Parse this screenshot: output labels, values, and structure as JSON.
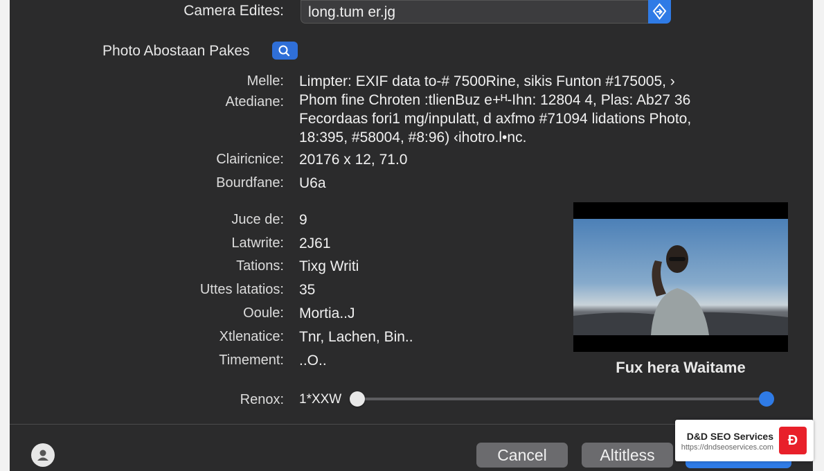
{
  "file": {
    "label": "Camera Edites:",
    "value": "long.tum er.jg"
  },
  "photo_section": {
    "label": "Photo Abostaan Pakes"
  },
  "description": {
    "label_1": "Melle:",
    "label_2": "Atediane:",
    "lines": [
      "Limpter: EXIF data to-# 7500Rine, sikis Funton  #175005,  ›",
      "Phom fine Chroten :tlienBuz e+ᴴ-Ihn: 12804 4, Plas: Ab27 36",
      "Fecordaas fori1 mg/inpulatt, d axfmo #71094 lidations Photo,",
      "18:395, #58004, #8:96) ‹ihotro.l•nc."
    ]
  },
  "fields": [
    {
      "label": "Clairicnice:",
      "value": "20176 x 12, 71.0"
    },
    {
      "label": "Bourdfane:",
      "value": "U6a"
    },
    {
      "label": "Juce de:",
      "value": "9"
    },
    {
      "label": "Latwrite:",
      "value": "2J61"
    },
    {
      "label": "Tations:",
      "value": "Tixg Writi"
    },
    {
      "label": "Uttes latatios:",
      "value": "35"
    },
    {
      "label": "Ooule:",
      "value": "Mortia..J"
    },
    {
      "label": "Xtlenatice:",
      "value": "Tnr, Lachen, Bin.."
    },
    {
      "label": "Timement:",
      "value": "..O.."
    }
  ],
  "preview": {
    "caption": "Fux hera Waitame"
  },
  "slider": {
    "label": "Renox:",
    "value_text": "1*XXW",
    "level": 0
  },
  "buttons": {
    "cancel": "Cancel",
    "secondary": "Altitless",
    "primary": ""
  },
  "watermark": {
    "name": "D&D SEO Services",
    "url": "https://dndseoservices.com",
    "logo_text": "Ð"
  },
  "colors": {
    "dialog_bg": "#2b2b2c",
    "accent": "#2f7be6",
    "button_gray": "#6b6b6e",
    "watermark_red": "#e8202a"
  },
  "icons": [
    "stepper-icon",
    "search-icon",
    "user-icon"
  ]
}
